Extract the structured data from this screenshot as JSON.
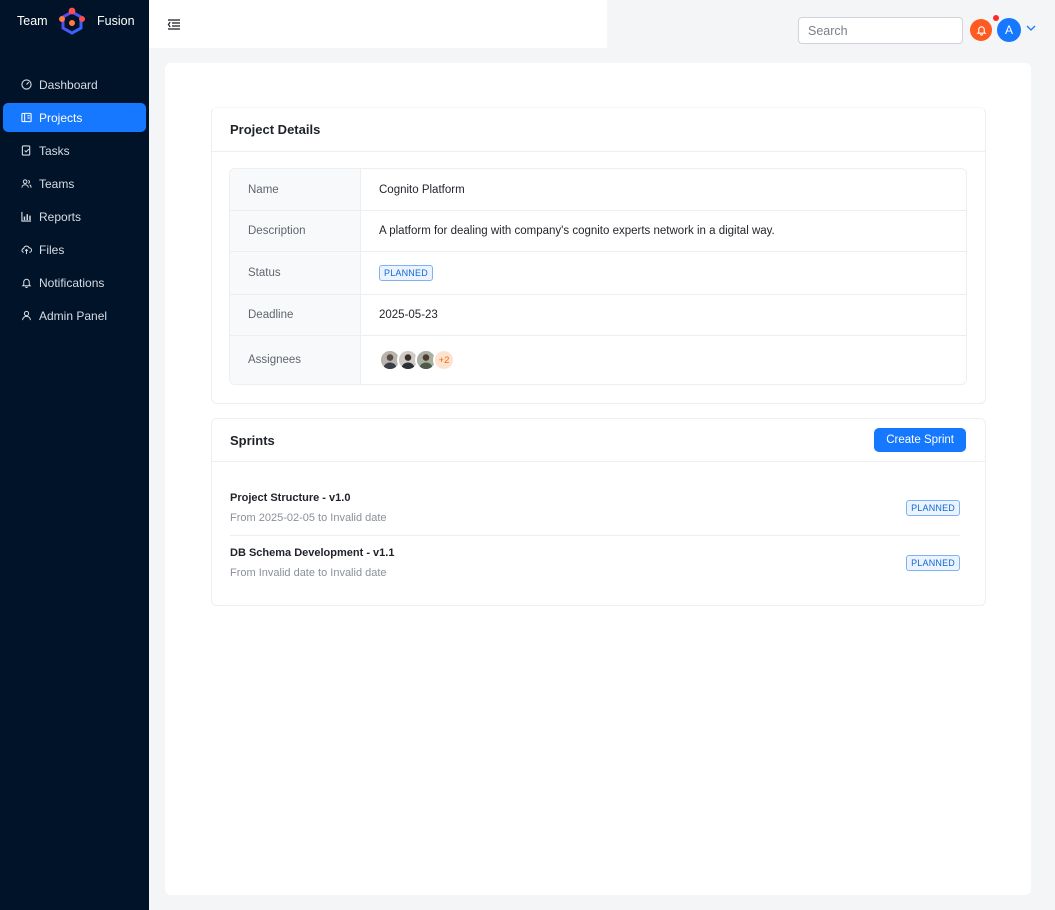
{
  "brand": {
    "left": "Team",
    "right": "Fusion"
  },
  "nav": [
    {
      "label": "Dashboard",
      "icon": "dashboard-icon",
      "active": false
    },
    {
      "label": "Projects",
      "icon": "projects-icon",
      "active": true
    },
    {
      "label": "Tasks",
      "icon": "tasks-icon",
      "active": false
    },
    {
      "label": "Teams",
      "icon": "teams-icon",
      "active": false
    },
    {
      "label": "Reports",
      "icon": "reports-icon",
      "active": false
    },
    {
      "label": "Files",
      "icon": "files-icon",
      "active": false
    },
    {
      "label": "Notifications",
      "icon": "notifications-icon",
      "active": false
    },
    {
      "label": "Admin Panel",
      "icon": "admin-icon",
      "active": false
    }
  ],
  "header": {
    "search_placeholder": "Search",
    "avatar_initial": "A"
  },
  "project": {
    "section_title": "Project Details",
    "rows": [
      {
        "label": "Name",
        "value": "Cognito Platform"
      },
      {
        "label": "Description",
        "value": "A platform for dealing with company's cognito experts network in a digital way."
      },
      {
        "label": "Status",
        "value": "PLANNED"
      },
      {
        "label": "Deadline",
        "value": "2025-05-23"
      },
      {
        "label": "Assignees",
        "extra_count": "+2"
      }
    ]
  },
  "sprints": {
    "title": "Sprints",
    "create_label": "Create Sprint",
    "items": [
      {
        "name": "Project Structure - v1.0",
        "range": "From 2025-02-05 to Invalid date",
        "status": "PLANNED"
      },
      {
        "name": "DB Schema Development - v1.1",
        "range": "From Invalid date to Invalid date",
        "status": "PLANNED"
      }
    ]
  },
  "colors": {
    "sidebar_bg": "#011328",
    "accent": "#1677ff",
    "bell": "#ff5a1f",
    "tag_text": "#1368d1"
  }
}
